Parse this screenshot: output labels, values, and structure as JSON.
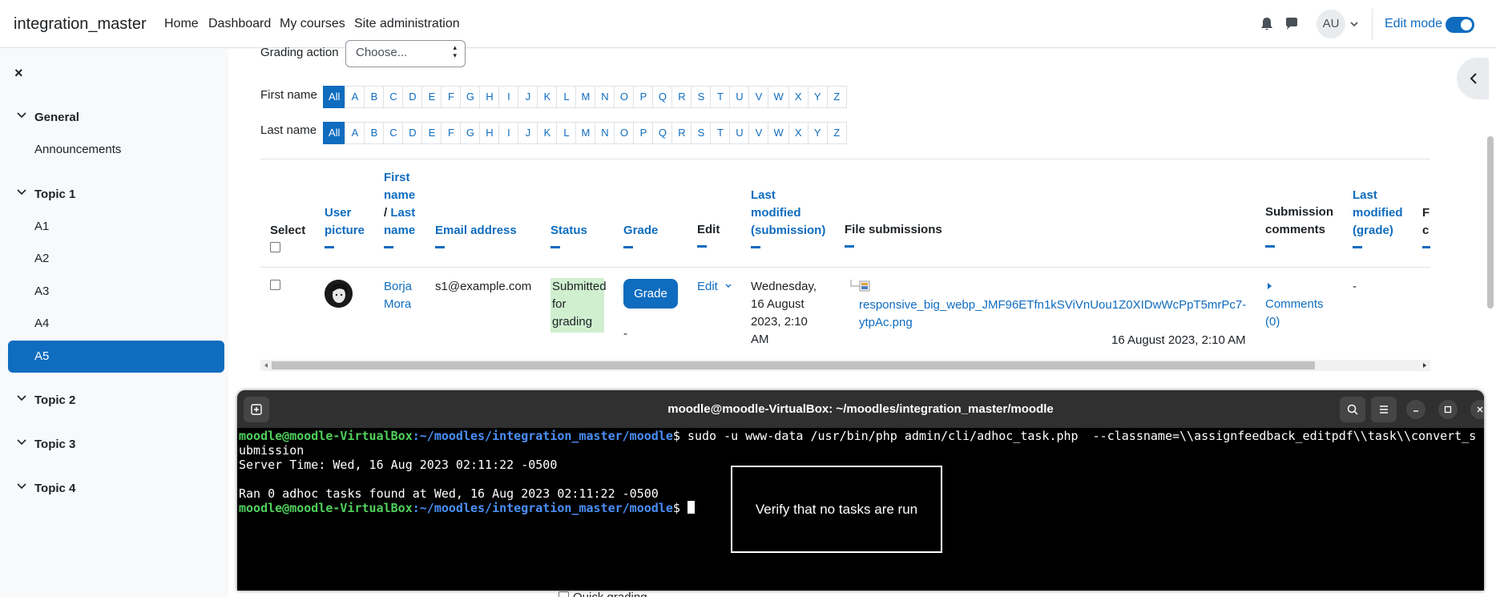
{
  "navbar": {
    "brand": "integration_master",
    "links": [
      "Home",
      "Dashboard",
      "My courses",
      "Site administration"
    ],
    "avatar_initials": "AU",
    "edit_mode_label": "Edit mode"
  },
  "drawer": {
    "close": "×",
    "sections": [
      {
        "title": "General",
        "items": [
          "Announcements"
        ]
      },
      {
        "title": "Topic 1",
        "items": [
          "A1",
          "A2",
          "A3",
          "A4",
          "A5"
        ]
      },
      {
        "title": "Topic 2",
        "items": []
      },
      {
        "title": "Topic 3",
        "items": []
      },
      {
        "title": "Topic 4",
        "items": []
      }
    ],
    "active_item": "A5"
  },
  "grading_action": {
    "label": "Grading action",
    "placeholder": "Choose..."
  },
  "filters": {
    "first_name_label": "First name",
    "last_name_label": "Last name",
    "letters": [
      "All",
      "A",
      "B",
      "C",
      "D",
      "E",
      "F",
      "G",
      "H",
      "I",
      "J",
      "K",
      "L",
      "M",
      "N",
      "O",
      "P",
      "Q",
      "R",
      "S",
      "T",
      "U",
      "V",
      "W",
      "X",
      "Y",
      "Z"
    ]
  },
  "table": {
    "headers": {
      "select": "Select",
      "user_picture_1": "User",
      "user_picture_2": "picture",
      "first_name_1": "First",
      "first_name_2": "name",
      "slash": "/ ",
      "last_name_1": "Last",
      "last_name_2": "name",
      "email": "Email address",
      "status": "Status",
      "grade": "Grade",
      "edit": "Edit",
      "last_modified_sub_1": "Last",
      "last_modified_sub_2": "modified",
      "last_modified_sub_3": "(submission)",
      "file_submissions": "File submissions",
      "submission_comments_1": "Submission",
      "submission_comments_2": "comments",
      "last_modified_grade_1": "Last",
      "last_modified_grade_2": "modified",
      "last_modified_grade_3": "(grade)",
      "final_partial_1": "F",
      "final_partial_2": "c"
    },
    "row": {
      "first_name": "Borja",
      "last_name": "Mora",
      "email": "s1@example.com",
      "status_1": "Submitted",
      "status_2": "for",
      "status_3": "grading",
      "grade_button": "Grade",
      "grade_value": "-",
      "edit_link": "Edit",
      "modified_1": "Wednesday,",
      "modified_2": "16 August",
      "modified_3": "2023, 2:10",
      "modified_4": "AM",
      "file_name_1": "responsive_big_webp_JMF96ETfn1kSViVnUou1Z0XIDwWcPpT5mrPc7-",
      "file_name_2": "ytpAc.png",
      "file_date": "16 August 2023, 2:10 AM",
      "comments_1": "Comments",
      "comments_2": "(0)",
      "last_modified_grade": "-"
    }
  },
  "terminal": {
    "title": "moodle@moodle-VirtualBox: ~/moodles/integration_master/moodle",
    "prompt_user": "moodle@moodle-VirtualBox",
    "prompt_path": ":~/moodles/integration_master/moodle",
    "prompt_symbol": "$ ",
    "command_1": "sudo -u www-data /usr/bin/php admin/cli/adhoc_task.php  --classname=\\\\assignfeedback_editpdf\\\\task\\\\convert_s",
    "command_2": "ubmission",
    "output_1": "Server Time: Wed, 16 Aug 2023 02:11:22 -0500",
    "output_2": "Ran 0 adhoc tasks found at Wed, 16 Aug 2023 02:11:22 -0500"
  },
  "annotation": "Verify that no tasks are run",
  "quick_grading": "Quick grading",
  "colors": {
    "primary": "#0f6cbf",
    "success_bg": "#cfefcf",
    "terminal_bg": "#000000",
    "prompt_green": "#4fd05b",
    "prompt_blue": "#4a8ff7"
  }
}
